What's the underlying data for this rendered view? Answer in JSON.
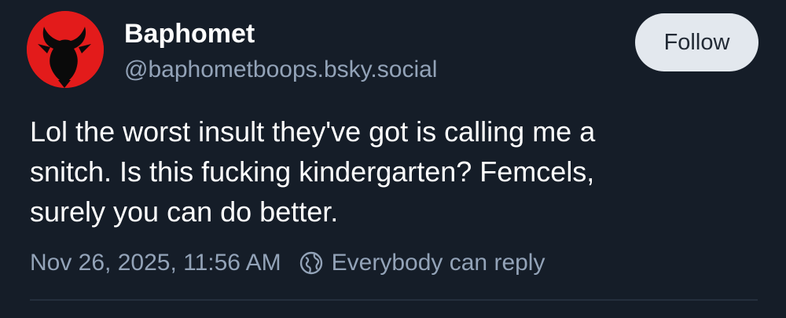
{
  "post": {
    "author": {
      "display_name": "Baphomet",
      "handle": "@baphometboops.bsky.social",
      "avatar_icon": "goat-head-icon",
      "avatar_color": "#e31b1b"
    },
    "follow_label": "Follow",
    "text": "Lol the worst insult they've got is calling me a\nsnitch. Is this fucking kindergarten? Femcels,\nsurely you can do better.",
    "timestamp": "Nov 26, 2025, 11:56 AM",
    "reply_setting_icon": "globe-icon",
    "reply_setting": "Everybody can reply"
  },
  "colors": {
    "background": "#151d28",
    "muted_text": "#93a3b8",
    "button_bg": "#e3e8ee"
  }
}
